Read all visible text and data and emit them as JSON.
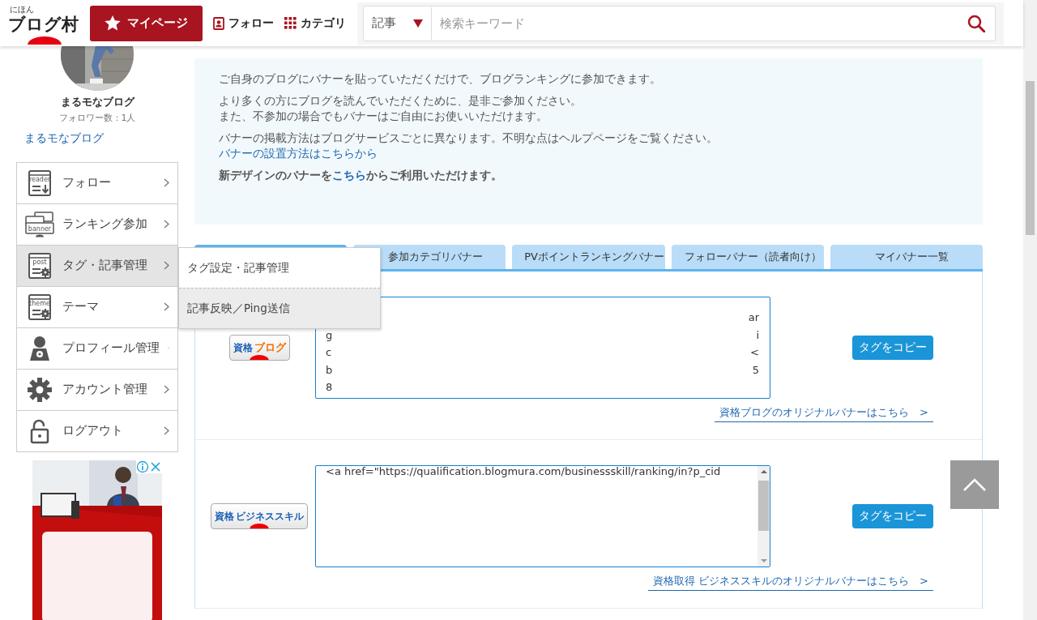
{
  "header": {
    "logo": {
      "small": "にほん",
      "main": "ブログ村"
    },
    "mypage_button": "マイページ",
    "links": [
      {
        "label": "フォロー",
        "kind": "follow"
      },
      {
        "label": "カテゴリ",
        "kind": "category"
      }
    ],
    "search": {
      "scope": "記事",
      "placeholder": "検索キーワード"
    }
  },
  "profile": {
    "name": "まるモなブログ",
    "followers": "フォロワー数：1人",
    "blog_link": "まるモなブログ"
  },
  "sidebar": {
    "items": [
      {
        "label": "フォロー",
        "kind": "doc-arrow",
        "icon_label": "reader",
        "selected": false
      },
      {
        "label": "ランキング参加",
        "kind": "banner",
        "icon_label": "banner",
        "selected": false
      },
      {
        "label": "タグ・記事管理",
        "kind": "doc-gear",
        "icon_label": "post",
        "selected": true
      },
      {
        "label": "テーマ",
        "kind": "doc-gear",
        "icon_label": "theme",
        "selected": false
      },
      {
        "label": "プロフィール管理",
        "kind": "person",
        "selected": false
      },
      {
        "label": "アカウント管理",
        "kind": "gear",
        "selected": false
      },
      {
        "label": "ログアウト",
        "kind": "lock",
        "selected": false
      }
    ]
  },
  "submenu": {
    "items": [
      {
        "label": "タグ設定・記事管理",
        "hover": false
      },
      {
        "label": "記事反映／Ping送信",
        "hover": true
      }
    ]
  },
  "info": {
    "paragraphs": [
      {
        "bold": false,
        "lines": [
          [
            {
              "kind": "text",
              "text": "ご自身のブログにバナーを貼っていただくだけで、ブログランキングに参加できます。"
            }
          ]
        ]
      },
      {
        "bold": false,
        "lines": [
          [
            {
              "kind": "text",
              "text": "より多くの方にブログを読んでいただくために、是非ご参加ください。"
            }
          ],
          [
            {
              "kind": "text",
              "text": "また、不参加の場合でもバナーはご自由にお使いいただけます。"
            }
          ]
        ]
      },
      {
        "bold": false,
        "lines": [
          [
            {
              "kind": "text",
              "text": "バナーの掲載方法はブログサービスごとに異なります。不明な点はヘルプページをご覧ください。"
            }
          ],
          [
            {
              "kind": "link",
              "text": "バナーの設置方法はこちらから"
            }
          ]
        ]
      },
      {
        "bold": true,
        "lines": [
          [
            {
              "kind": "text",
              "text": "新デザインのバナーを"
            },
            {
              "kind": "link",
              "text": "こちら"
            },
            {
              "kind": "text",
              "text": "からご利用いただけます。"
            }
          ]
        ]
      }
    ]
  },
  "tabs": [
    {
      "selected": true
    },
    {
      "label": "参加カテゴリバナー",
      "selected": false
    },
    {
      "label": "PVポイントランキングバナー",
      "selected": false
    },
    {
      "label": "フォローバナー（読者向け）",
      "selected": false
    },
    {
      "label": "マイバナー一覧",
      "selected": false
    }
  ],
  "banners": [
    {
      "badge": {
        "kind": "blog",
        "title": "資格",
        "subtitle": "ブログ"
      },
      "code_lines": [
        {
          "end": "ar"
        },
        {
          "start": "g",
          "end": "i"
        },
        {
          "start": "c",
          "end": "<"
        },
        {
          "start": "b",
          "end": "5"
        },
        {
          "start": "8"
        }
      ],
      "has_scrollbar": false,
      "copy_button": "タグをコピー",
      "original_link": "資格ブログのオリジナルバナーはこちら　>"
    },
    {
      "badge": {
        "kind": "skill",
        "title": "資格",
        "subtitle": "ビジネススキル"
      },
      "code_lines": [
        {
          "start": "<a href=\"https://qualification.blogmura.com/businessskill/ranking/in?p_cid"
        }
      ],
      "has_scrollbar": true,
      "copy_button": "タグをコピー",
      "original_link": "資格取得 ビジネススキルのオリジナルバナーはこちら　>"
    }
  ]
}
